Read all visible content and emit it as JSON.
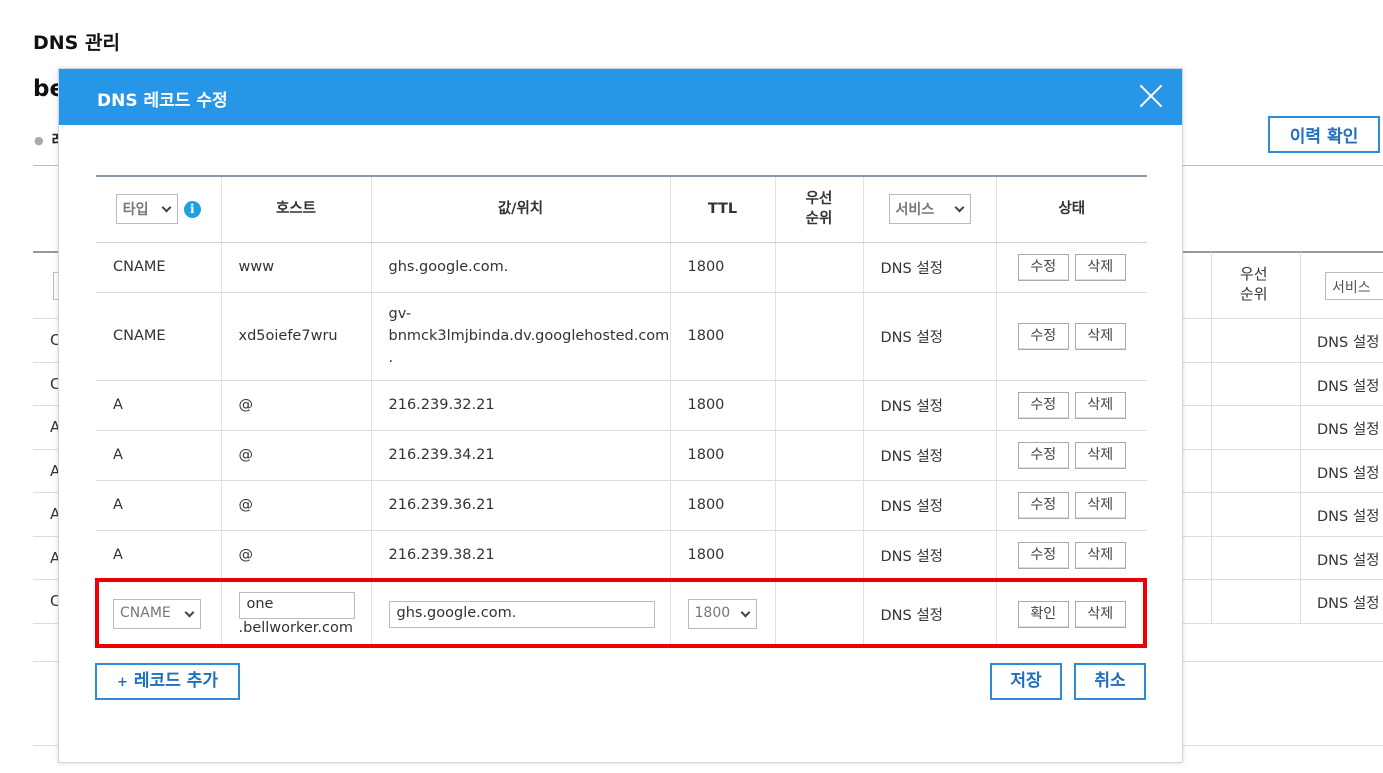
{
  "background": {
    "page_title": "DNS 관리",
    "domain_fragment": "be",
    "section_fragment": "레",
    "history_button": "이력 확인",
    "priority_header": [
      "우선",
      "순위"
    ],
    "service_select": "서비스",
    "row_type_letters": [
      "C",
      "C",
      "A",
      "A",
      "A",
      "A",
      "C"
    ],
    "row_status": [
      "DNS 설정",
      "DNS 설정",
      "DNS 설정",
      "DNS 설정",
      "DNS 설정",
      "DNS 설정",
      "DNS 설정"
    ]
  },
  "modal": {
    "title": "DNS 레코드 수정",
    "columns": {
      "type_select": "타입",
      "info": "i",
      "host": "호스트",
      "value": "값/위치",
      "ttl": "TTL",
      "priority_line1": "우선",
      "priority_line2": "순위",
      "service_select": "서비스",
      "status": "상태"
    },
    "records": [
      {
        "type": "CNAME",
        "host": "www",
        "value": "ghs.google.com.",
        "ttl": "1800",
        "priority": "",
        "status": "DNS 설정",
        "edit": "수정",
        "delete": "삭제"
      },
      {
        "type": "CNAME",
        "host": "xd5oiefe7wru",
        "value_lines": [
          "gv-",
          "bnmck3lmjbinda.dv.googlehosted.com",
          "."
        ],
        "ttl": "1800",
        "priority": "",
        "status": "DNS 설정",
        "edit": "수정",
        "delete": "삭제"
      },
      {
        "type": "A",
        "host": "@",
        "value": "216.239.32.21",
        "ttl": "1800",
        "priority": "",
        "status": "DNS 설정",
        "edit": "수정",
        "delete": "삭제"
      },
      {
        "type": "A",
        "host": "@",
        "value": "216.239.34.21",
        "ttl": "1800",
        "priority": "",
        "status": "DNS 설정",
        "edit": "수정",
        "delete": "삭제"
      },
      {
        "type": "A",
        "host": "@",
        "value": "216.239.36.21",
        "ttl": "1800",
        "priority": "",
        "status": "DNS 설정",
        "edit": "수정",
        "delete": "삭제"
      },
      {
        "type": "A",
        "host": "@",
        "value": "216.239.38.21",
        "ttl": "1800",
        "priority": "",
        "status": "DNS 설정",
        "edit": "수정",
        "delete": "삭제"
      }
    ],
    "edit_row": {
      "type_value": "CNAME",
      "host_value": "one",
      "host_suffix": ".bellworker.com",
      "value_value": "ghs.google.com.",
      "ttl_value": "1800",
      "status": "DNS 설정",
      "confirm": "확인",
      "delete": "삭제"
    },
    "add_record_button": "레코드 추가",
    "add_record_plus": "+",
    "save_button": "저장",
    "cancel_button": "취소"
  },
  "colors": {
    "header_blue": "#2896e6",
    "button_border": "#2f8ad8",
    "highlight_red": "#ee0000",
    "info_icon": "#1da1e3"
  }
}
